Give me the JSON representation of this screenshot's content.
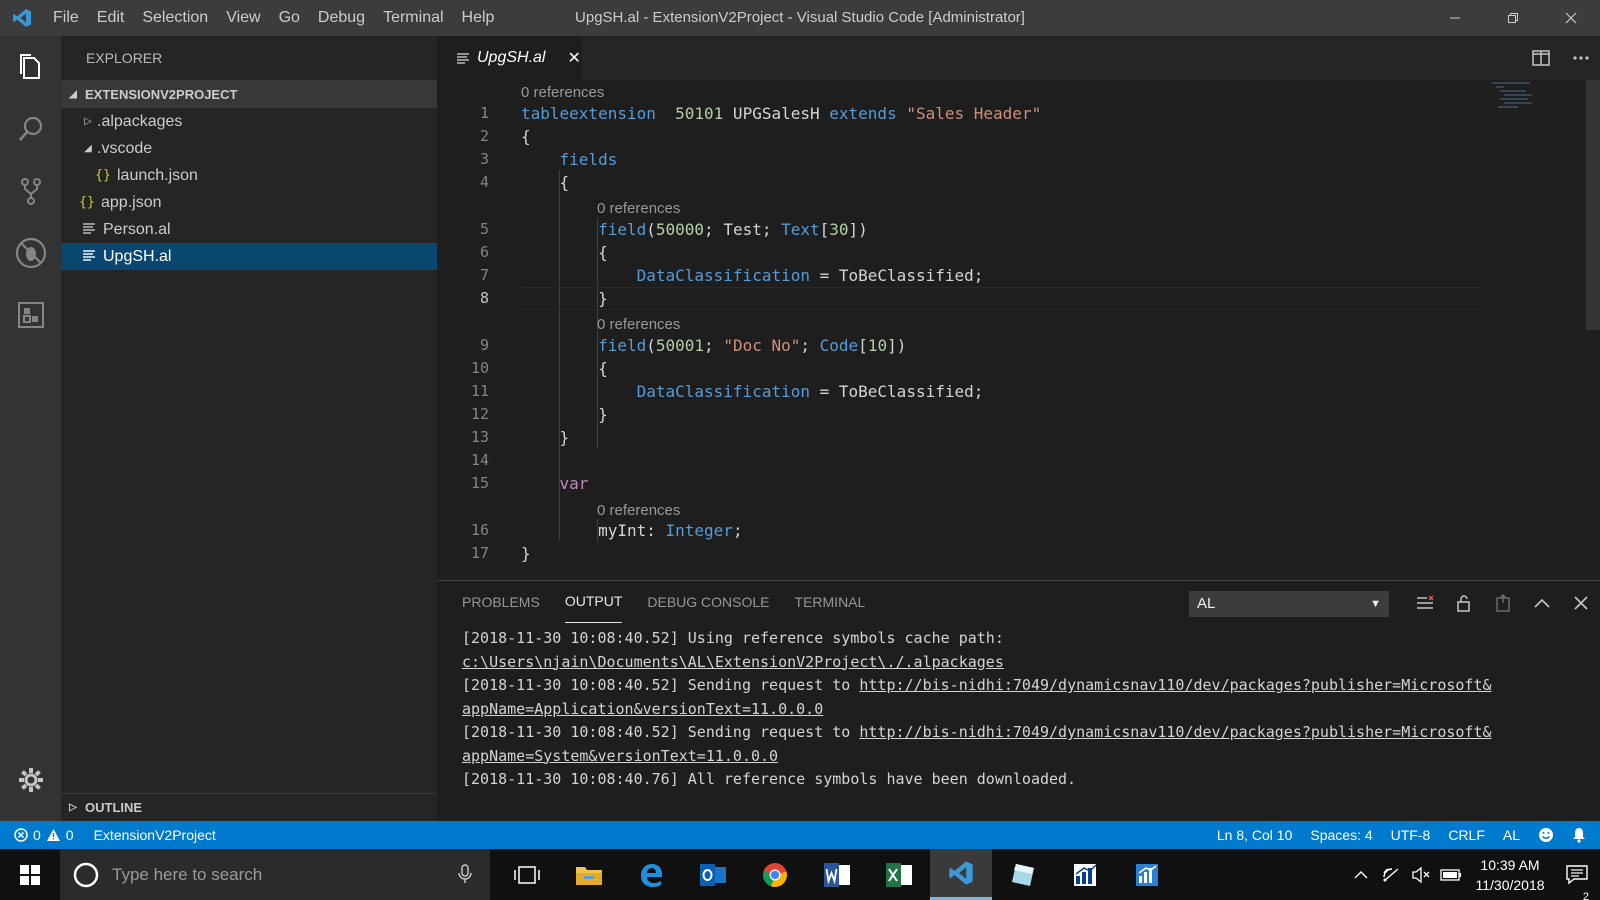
{
  "titlebar": {
    "menu": [
      "File",
      "Edit",
      "Selection",
      "View",
      "Go",
      "Debug",
      "Terminal",
      "Help"
    ],
    "title": "UpgSH.al - ExtensionV2Project - Visual Studio Code [Administrator]"
  },
  "sidebar": {
    "header": "EXPLORER",
    "project": "EXTENSIONV2PROJECT",
    "tree": [
      {
        "label": ".alpackages",
        "type": "folder-collapsed"
      },
      {
        "label": ".vscode",
        "type": "folder-expanded"
      },
      {
        "label": "launch.json",
        "type": "json"
      },
      {
        "label": "app.json",
        "type": "json"
      },
      {
        "label": "Person.al",
        "type": "al"
      },
      {
        "label": "UpgSH.al",
        "type": "al",
        "selected": true
      }
    ],
    "json_icon": "{}",
    "outline": "OUTLINE"
  },
  "tab": {
    "label": "UpgSH.al",
    "close": "✕"
  },
  "editor": {
    "lens": "0 references",
    "line_numbers": [
      "1",
      "2",
      "3",
      "4",
      "5",
      "6",
      "7",
      "8",
      "9",
      "10",
      "11",
      "12",
      "13",
      "14",
      "15",
      "16",
      "17"
    ],
    "active_line": 8,
    "lines": [
      {
        "n": "1",
        "segments": [
          [
            "kw",
            "tableextension"
          ],
          [
            "",
            "  "
          ],
          [
            "num",
            "50101"
          ],
          [
            "",
            " UPGSalesH "
          ],
          [
            "kw",
            "extends"
          ],
          [
            "",
            " "
          ],
          [
            "str",
            "\"Sales Header\""
          ]
        ]
      },
      {
        "n": "2",
        "segments": [
          [
            "",
            "{"
          ]
        ]
      },
      {
        "n": "3",
        "segments": [
          [
            "",
            "    "
          ],
          [
            "kw",
            "fields"
          ]
        ]
      },
      {
        "n": "4",
        "segments": [
          [
            "",
            "    {"
          ]
        ]
      },
      {
        "n": "5",
        "segments": [
          [
            "",
            "        "
          ],
          [
            "kw",
            "field"
          ],
          [
            "",
            "("
          ],
          [
            "num",
            "50000"
          ],
          [
            "",
            "; Test; "
          ],
          [
            "kw",
            "Text"
          ],
          [
            "",
            "["
          ],
          [
            "num",
            "30"
          ],
          [
            "",
            "])"
          ]
        ]
      },
      {
        "n": "6",
        "segments": [
          [
            "",
            "        {"
          ]
        ]
      },
      {
        "n": "7",
        "segments": [
          [
            "",
            "            "
          ],
          [
            "prop",
            "DataClassification"
          ],
          [
            "",
            " = ToBeClassified;"
          ]
        ]
      },
      {
        "n": "8",
        "segments": [
          [
            "",
            "        }"
          ]
        ]
      },
      {
        "n": "9",
        "segments": [
          [
            "",
            "        "
          ],
          [
            "kw",
            "field"
          ],
          [
            "",
            "("
          ],
          [
            "num",
            "50001"
          ],
          [
            "",
            "; "
          ],
          [
            "str",
            "\"Doc No\""
          ],
          [
            "",
            "; "
          ],
          [
            "kw",
            "Code"
          ],
          [
            "",
            "["
          ],
          [
            "num",
            "10"
          ],
          [
            "",
            "])"
          ]
        ]
      },
      {
        "n": "10",
        "segments": [
          [
            "",
            "        {"
          ]
        ]
      },
      {
        "n": "11",
        "segments": [
          [
            "",
            "            "
          ],
          [
            "prop",
            "DataClassification"
          ],
          [
            "",
            " = ToBeClassified;"
          ]
        ]
      },
      {
        "n": "12",
        "segments": [
          [
            "",
            "        }"
          ]
        ]
      },
      {
        "n": "13",
        "segments": [
          [
            "",
            "    }"
          ]
        ]
      },
      {
        "n": "14",
        "segments": [
          [
            "",
            ""
          ]
        ]
      },
      {
        "n": "15",
        "segments": [
          [
            "",
            "    "
          ],
          [
            "var",
            "var"
          ]
        ]
      },
      {
        "n": "16",
        "segments": [
          [
            "",
            "        myInt: "
          ],
          [
            "kw",
            "Integer"
          ],
          [
            "",
            ";"
          ]
        ]
      },
      {
        "n": "17",
        "segments": [
          [
            "",
            "}"
          ]
        ]
      }
    ]
  },
  "panel": {
    "tabs": [
      "PROBLEMS",
      "OUTPUT",
      "DEBUG CONSOLE",
      "TERMINAL"
    ],
    "active_tab": "OUTPUT",
    "channel": "AL",
    "output": [
      {
        "text": "[2018-11-30 10:08:40.52] Using reference symbols cache path:",
        "link": ""
      },
      {
        "text": "",
        "link": "c:\\Users\\njain\\Documents\\AL\\ExtensionV2Project\\./.alpackages"
      },
      {
        "text": "[2018-11-30 10:08:40.52] Sending request to ",
        "link": "http://bis-nidhi:7049/dynamicsnav110/dev/packages?publisher=Microsoft&"
      },
      {
        "text": "",
        "link": "appName=Application&versionText=11.0.0.0"
      },
      {
        "text": "[2018-11-30 10:08:40.52] Sending request to ",
        "link": "http://bis-nidhi:7049/dynamicsnav110/dev/packages?publisher=Microsoft&"
      },
      {
        "text": "",
        "link": "appName=System&versionText=11.0.0.0"
      },
      {
        "text": "[2018-11-30 10:08:40.76] All reference symbols have been downloaded.",
        "link": ""
      }
    ]
  },
  "statusbar": {
    "errors": "0",
    "warnings": "0",
    "folder": "ExtensionV2Project",
    "position": "Ln 8, Col 10",
    "spaces": "Spaces: 4",
    "encoding": "UTF-8",
    "eol": "CRLF",
    "language": "AL"
  },
  "taskbar": {
    "search_placeholder": "Type here to search",
    "time": "10:39 AM",
    "date": "11/30/2018",
    "notifications": "2"
  },
  "colors": {
    "accent": "#007acc",
    "selection": "#094771",
    "keyword": "#569cd6",
    "string": "#ce9178",
    "number": "#b5cea8",
    "control": "#c586c0"
  }
}
